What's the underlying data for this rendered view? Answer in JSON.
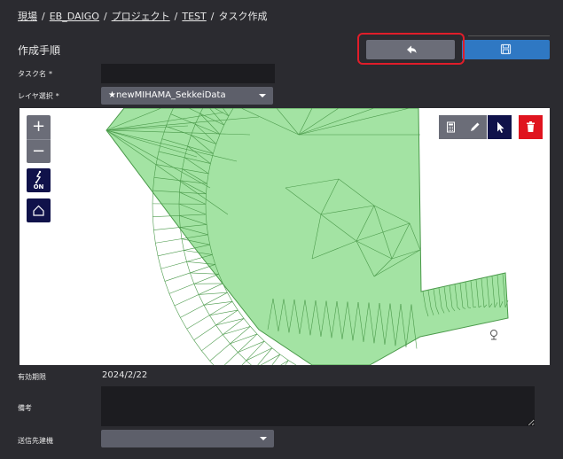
{
  "breadcrumb": {
    "items": [
      "現場",
      "EB_DAIGO",
      "プロジェクト",
      "TEST"
    ],
    "separator": "/",
    "current": "タスク作成"
  },
  "page_title": "作成手順",
  "toolbar": {
    "back_icon": "undo-arrow-icon",
    "save_icon": "floppy-disk-icon"
  },
  "form": {
    "task_name_label": "タスク名",
    "required_mark": "*",
    "task_name_value": "",
    "layer_label": "レイヤ選択",
    "layer_value": "★newMIHAMA_SekkeiData",
    "expiry_label": "有効期限",
    "expiry_value": "2024/2/22",
    "remarks_label": "備考",
    "remarks_value": "",
    "destination_label": "送信先建機",
    "destination_value": ""
  },
  "map": {
    "zoom_in": "+",
    "zoom_out": "−",
    "snap_badge": "ON",
    "mesh_fill": "#a3e3a3",
    "mesh_stroke": "#4b9a4b",
    "tools": [
      "calculator-icon",
      "pencil-icon",
      "pointer-icon",
      "trash-icon"
    ]
  },
  "colors": {
    "background": "#2b2b30",
    "save_button": "#2f78c3",
    "back_button": "#6b6d78",
    "highlight": "#e01d2a",
    "delete_button": "#e0141f",
    "active_tool": "#10124a"
  }
}
